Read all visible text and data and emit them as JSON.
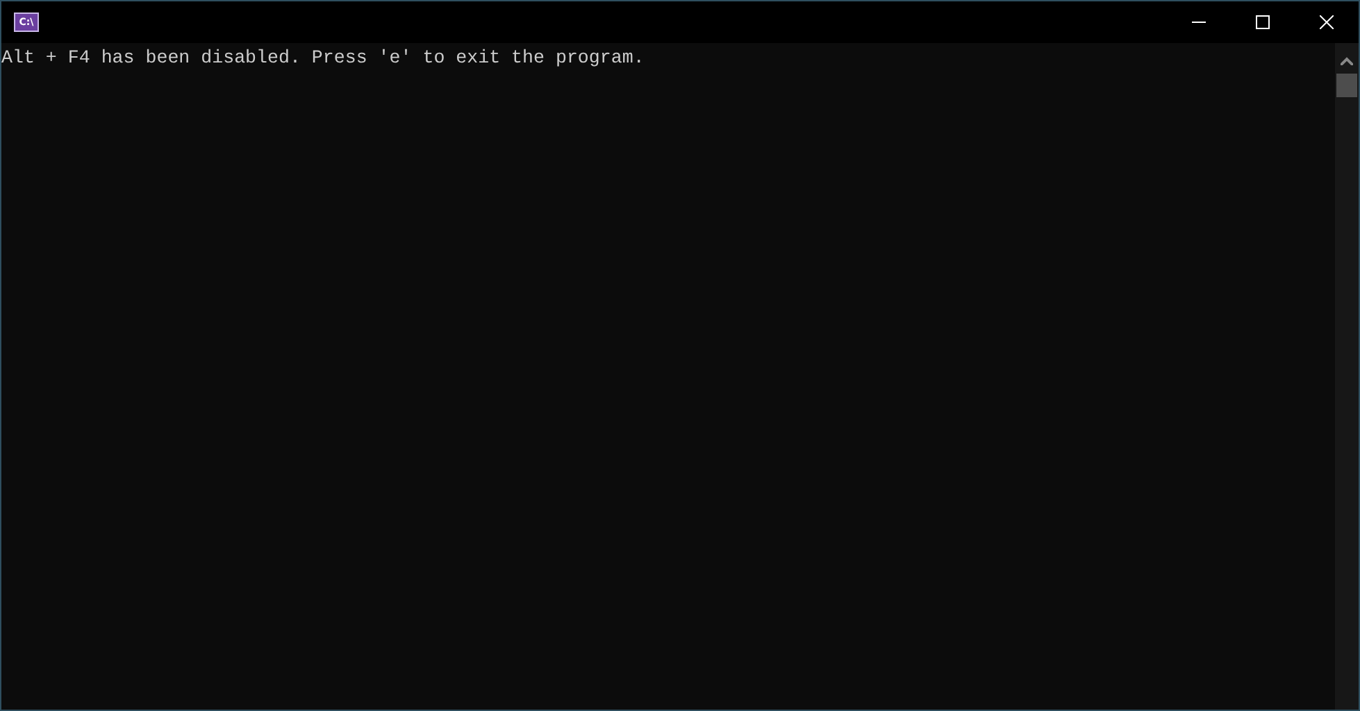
{
  "window": {
    "icon_text": "C:\\"
  },
  "console": {
    "lines": [
      "Alt + F4 has been disabled. Press 'e' to exit the program."
    ]
  }
}
